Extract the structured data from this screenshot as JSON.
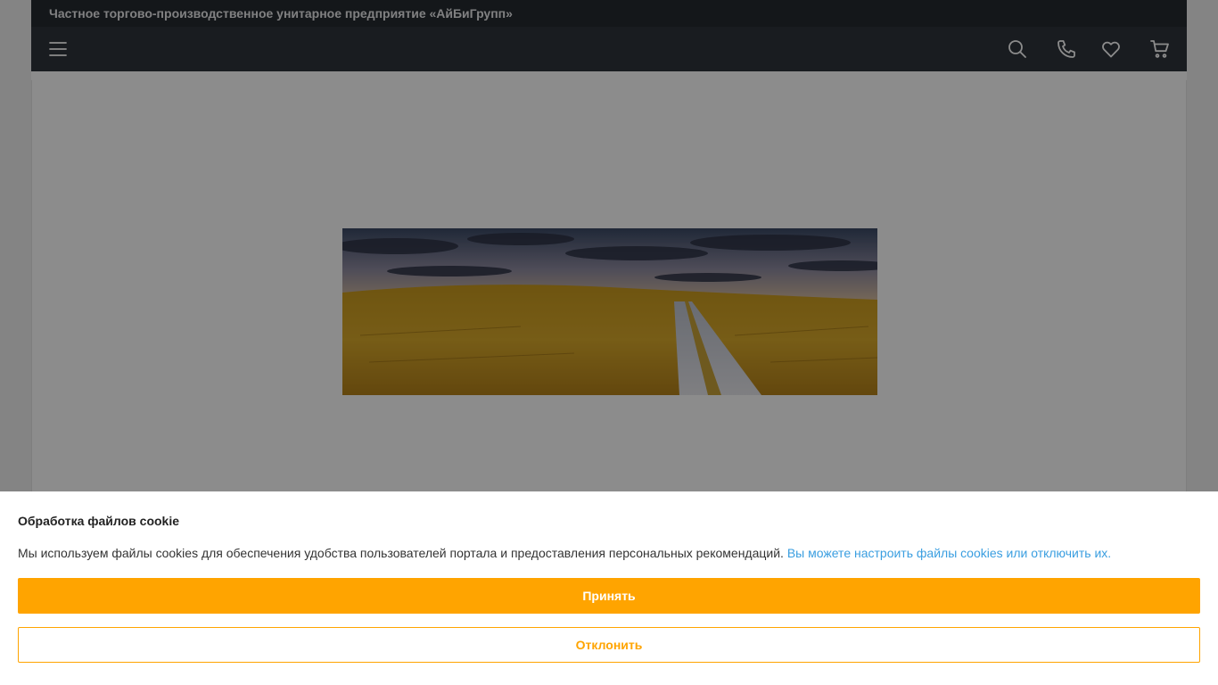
{
  "header": {
    "company_name": "Частное торгово-производственное унитарное предприятие «АйБиГрупп»"
  },
  "navbar": {
    "icons": [
      "menu-icon",
      "search-icon",
      "phone-icon",
      "heart-icon",
      "cart-icon"
    ]
  },
  "banner": {
    "image": "wheat-field-road-sunset"
  },
  "cookie_banner": {
    "title": "Обработка файлов cookie",
    "text": "Мы используем файлы cookies для обеспечения удобства пользователей портала и предоставления персональных рекомендаций.",
    "link_text": "Вы можете настроить файлы cookies или отключить их.",
    "accept_label": "Принять",
    "decline_label": "Отклонить"
  },
  "colors": {
    "accent": "#ffa400",
    "link": "#3a9ee0",
    "header_dark": "#252a31",
    "navbar": "#2f343b"
  }
}
